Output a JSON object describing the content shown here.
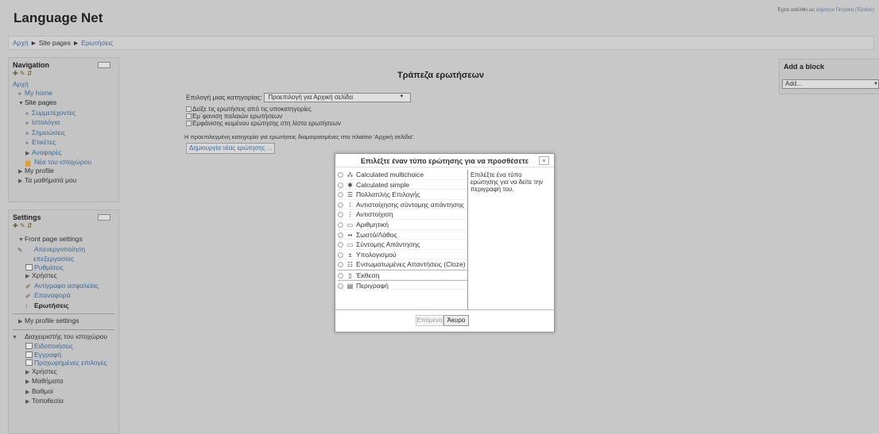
{
  "header": {
    "logo": "Language Net",
    "login_text": "Έχετε εισέλθει ως ",
    "login_user": "Δήμητρα Πετράκη",
    "logout": " (Έξοδος)"
  },
  "breadcrumb": {
    "home": "Αρχή",
    "sep1": " ► ",
    "site_pages": "Site pages",
    "sep2": " ► ",
    "current": "Ερωτήσεις"
  },
  "navigation": {
    "title": "Navigation",
    "home": "Αρχή",
    "my_home": "My home",
    "site_pages": "Site pages",
    "items": [
      "Συμμετέχοντες",
      "Ιστολόγια",
      "Σημειώσεις",
      "Ετικέτες"
    ],
    "reports": "Αναφορές",
    "site_news": "Νέα του ιστοχώρου",
    "my_profile": "My profile",
    "my_courses": "Τα μαθήματά μου"
  },
  "settings": {
    "title": "Settings",
    "front_page": "Front page settings",
    "turn_off_editing": "Απενεργοποίηση επεξεργασίας",
    "settings_item": "Ρυθμίσεις",
    "users": "Χρήστες",
    "backup": "Αντίγραφο ασφαλείας",
    "restore": "Επαναφορά",
    "questions": "Ερωτήσεις",
    "my_profile_settings": "My profile settings",
    "site_admin": "Διαχειριστής του ιστοχώρου",
    "notifications": "Ειδοποιήσεις",
    "registration": "Εγγραφή",
    "advanced": "Προχωρημένες επιλογές",
    "admin_users": "Χρήστες",
    "courses": "Μαθήματα",
    "grades": "Βαθμοί",
    "location": "Τοποθεσία"
  },
  "main": {
    "title": "Τράπεζα ερωτήσεων",
    "category_label": "Επιλογή μιας κατηγορίας:",
    "category_value": "Προεπιλογή για Αρχική σελίδα",
    "options": [
      "Δείξε τις ερωτήσεις από τις υποκατηγορίες",
      "Εμ΄φανιση παλαιών ερωτήσεων",
      "Εμφάνισης κειμένου ερώτησης στη λίστα ερωτήσεων"
    ],
    "note": "Η προεπιλεγμένη κατηγορία για ερωτήσεις διαμοιρασμένες στο πλαίσιο 'Αρχική σελίδα'.",
    "create_button": "Δημιουργία νέας ερώτησης ..."
  },
  "dialog": {
    "title": "Επιλέξτε έναν τύπο ερώτησης για να προσθέσετε",
    "close": "×",
    "question_types": [
      "Calculated multichoice",
      "Calculated simple",
      "Πολλαπλής Επιλογής",
      "Αντιστοίχησης σύντομης απάντησης",
      "Αντιστοίχιση",
      "Αριθμητική",
      "Σωστό/Λάθος",
      "Σύντομης Απάντησης",
      "Υπολογισμού",
      "Ενσωματωμένες Απαντήσεις (Cloze)",
      "Έκθεση",
      "Περιγραφή"
    ],
    "description": "Επιλέξτε ένα τύπο ερώτησης για να δείτε την περιγραφή του.",
    "next_button": "Επόμενο",
    "cancel_button": "Άκυρο"
  },
  "add_block": {
    "title": "Add a block",
    "select_value": "Add..."
  }
}
